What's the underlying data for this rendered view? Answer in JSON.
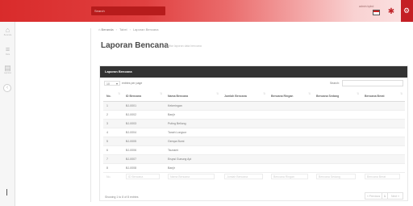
{
  "topbar": {
    "search_text": "Search",
    "user_name": "admin bpbd"
  },
  "sidebar": {
    "items": [
      {
        "icon": "home-icon",
        "glyph": "⌂",
        "label": "Beranda"
      },
      {
        "icon": "list-icon",
        "glyph": "≡",
        "label": "Data"
      },
      {
        "icon": "calendar-icon",
        "glyph": "▤",
        "label": "Laporan"
      }
    ],
    "collapse_glyph": "‹"
  },
  "breadcrumb": {
    "home": "Beranda",
    "items": [
      "Tabel",
      "Laporan Bencana"
    ]
  },
  "page": {
    "title": "Laporan Bencana",
    "subtitle": "daftar laporan data bencana"
  },
  "panel": {
    "title": "Laporan Bencana",
    "length_value": "10",
    "length_suffix": "entries per page",
    "search_label": "Search:"
  },
  "table": {
    "columns": [
      "No.",
      "ID Bencana",
      "Nama Bencana",
      "Jumlah Bencana",
      "Bencana Ringan",
      "Bencana Sedang",
      "Bencana Berat"
    ],
    "rows": [
      [
        "1",
        "BJ-0001",
        "Kekeringan",
        "",
        "",
        "",
        ""
      ],
      [
        "2",
        "BJ-0002",
        "Banjir",
        "",
        "",
        "",
        ""
      ],
      [
        "3",
        "BJ-0003",
        "Puting Beliung",
        "",
        "",
        "",
        ""
      ],
      [
        "4",
        "BJ-0004",
        "Tanah Longsor",
        "",
        "",
        "",
        ""
      ],
      [
        "5",
        "BJ-0005",
        "Gempa Bumi",
        "",
        "",
        "",
        ""
      ],
      [
        "6",
        "BJ-0006",
        "Tsunami",
        "",
        "",
        "",
        ""
      ],
      [
        "7",
        "BJ-0007",
        "Erupsi Gunung Api",
        "",
        "",
        "",
        ""
      ],
      [
        "8",
        "BJ-0008",
        "Banjir",
        "",
        "",
        "",
        ""
      ]
    ],
    "footer": [
      "No.",
      "ID Bencana",
      "Nama Bencana",
      "Jumlah Bencana",
      "Bencana Ringan",
      "Bencana Sedang",
      "Bencana Berat"
    ]
  },
  "info_text": "Showing 1 to 8 of 8 entries",
  "pagination": {
    "prev": "« Previous",
    "page": "1",
    "next": "Next »"
  }
}
